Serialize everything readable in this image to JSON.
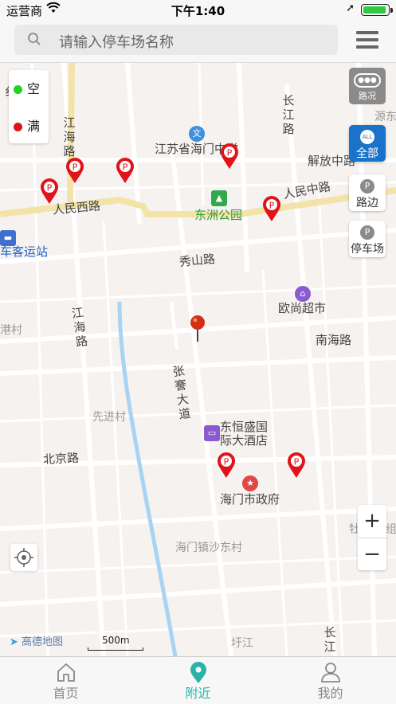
{
  "status_bar": {
    "carrier": "运营商",
    "time": "下午1:40",
    "battery_level": 0.9
  },
  "search": {
    "placeholder": "请输入停车场名称"
  },
  "legend": {
    "items": [
      {
        "label": "空",
        "color": "#21d421"
      },
      {
        "label": "满",
        "color": "#e0131a"
      }
    ]
  },
  "map_controls": {
    "traffic_label": "路况",
    "filters": [
      {
        "label": "全部",
        "icon": "ALL",
        "active": true
      },
      {
        "label": "路边",
        "icon": "P",
        "active": false
      },
      {
        "label": "停车场",
        "icon": "P",
        "active": false
      }
    ],
    "zoom_in": "+",
    "zoom_out": "−"
  },
  "map": {
    "labels": {
      "jianghai_n": "江海路",
      "jianghai_s": "江海路",
      "renmin_west": "人民西路",
      "renmin_mid": "人民中路",
      "jiefang": "解放中路",
      "changjiang_n": "长江路",
      "changjiang_s": "长江",
      "xiushan": "秀山路",
      "nanhai": "南海路",
      "zhangqian": "张謇大道",
      "beijing": "北京路",
      "yuan": "源东",
      "gang": "港村",
      "xianjin": "先进村",
      "shadong": "海门镇沙东村",
      "yujiang": "圩江",
      "mu": "牡",
      "zu": "组",
      "hai": "纟"
    },
    "pois": {
      "library": "江苏省海门中学",
      "park": "东洲公园",
      "bus_station": "车客运站",
      "supermarket": "欧尚超市",
      "hotel_line1": "东恒盛国",
      "hotel_line2": "际大酒店",
      "gov": "海门市政府"
    },
    "brand": "高德地图",
    "scale": "500m"
  },
  "tabs": [
    {
      "label": "首页",
      "icon": "home-icon",
      "active": false
    },
    {
      "label": "附近",
      "icon": "location-pin-icon",
      "active": true
    },
    {
      "label": "我的",
      "icon": "user-icon",
      "active": false
    }
  ],
  "colors": {
    "accent": "#2ab3a9",
    "active_filter": "#1a73c9",
    "pin": "#e0131a",
    "road_main": "#f3e3a6"
  }
}
